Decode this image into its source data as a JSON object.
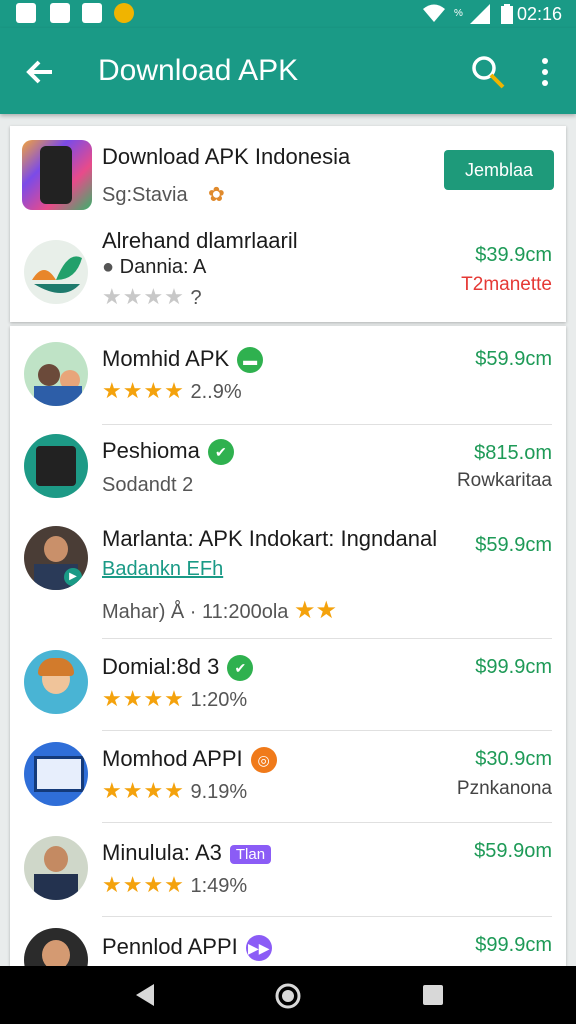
{
  "status_bar": {
    "time": "02:16",
    "left_icons": [
      "image-icon",
      "gallery-icon",
      "sim-icon",
      "app-icon"
    ],
    "right_icons": [
      "wifi-icon",
      "signal-icon",
      "battery-icon"
    ]
  },
  "app_bar": {
    "title": "Download APK",
    "back_icon": "back-arrow-icon",
    "search_icon": "search-icon",
    "more_icon": "more-vert-icon"
  },
  "featured": {
    "app1": {
      "name": "Download APK Indonesia",
      "sub": "Sg:Stavia",
      "button": "Jemblaa"
    },
    "app2": {
      "name": "Alrehand dlamrlaaril",
      "sub": "Dannia: A",
      "rating_text": "?",
      "price": "$39.9cm",
      "right_text": "T2manette"
    }
  },
  "list": [
    {
      "name": "Momhid APK",
      "rating_text": "2..9%",
      "price": "$59.9cm",
      "right_text": ""
    },
    {
      "name": "Peshioma",
      "sub": "Sodandt",
      "rating_text": "2",
      "price": "$815.om",
      "right_text": "Rowkaritaa"
    },
    {
      "name": "Marlanta: APK Indokart: Ingndanal",
      "sub_link": "Badankn EFh",
      "meta": "Mahar) Å · 11:200ola",
      "price": "$59.9cm",
      "right_text": ""
    },
    {
      "name": "Domial:8d 3",
      "rating_text": "1:20%",
      "price": "$99.9cm",
      "right_text": ""
    },
    {
      "name": "Momhod APPI",
      "rating_text": "9.19%",
      "price": "$30.9cm",
      "right_text": "Pznkanona"
    },
    {
      "name": "Minulula: A3",
      "pill": "Tlan",
      "rating_text": "1:49%",
      "price": "$59.9om",
      "right_text": ""
    },
    {
      "name": "Pennlod APPI",
      "price": "$99.9cm",
      "right_text": ""
    }
  ],
  "colors": {
    "primary": "#1a9a86",
    "price_green": "#1e9a57",
    "red_text": "#e53935",
    "star": "#f4a20c",
    "check_green": "#2fb14f"
  }
}
